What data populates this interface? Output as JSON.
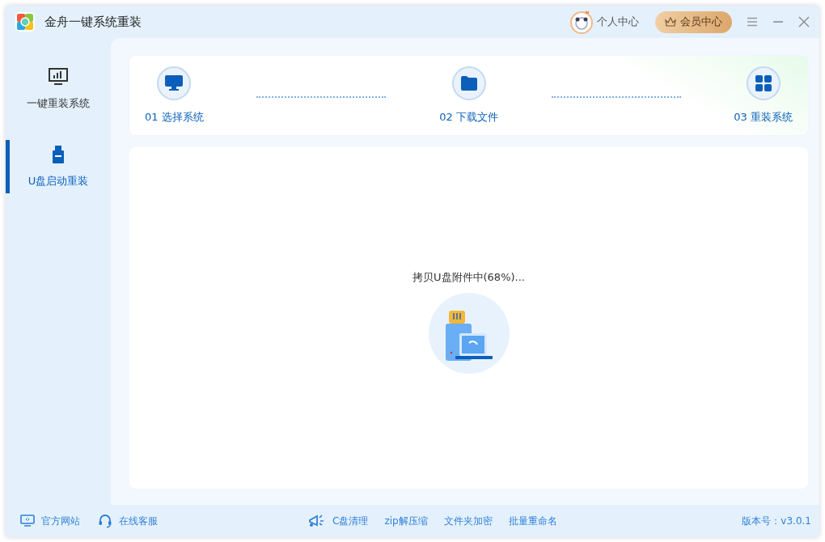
{
  "window": {
    "title": "金舟一键系统重装"
  },
  "header": {
    "user_center": "个人中心",
    "vip_center": "会员中心"
  },
  "sidebar": {
    "items": [
      {
        "label": "一键重装系统",
        "kind": "monitor",
        "selected": false
      },
      {
        "label": "U盘启动重装",
        "kind": "usb",
        "selected": true
      }
    ]
  },
  "steps": [
    {
      "label": "01 选择系统",
      "kind": "monitor"
    },
    {
      "label": "02 下载文件",
      "kind": "folder"
    },
    {
      "label": "03 重装系统",
      "kind": "grid"
    }
  ],
  "progress": {
    "message": "拷贝U盘附件中(68%)..."
  },
  "footer": {
    "left": [
      {
        "label": "官方网站",
        "kind": "monitor"
      },
      {
        "label": "在线客服",
        "kind": "headset"
      }
    ],
    "tools": [
      {
        "label": "C盘清理",
        "kind": "megaphone"
      },
      {
        "label": "zip解压缩",
        "kind": "text"
      },
      {
        "label": "文件夹加密",
        "kind": "text"
      },
      {
        "label": "批量重命名",
        "kind": "text"
      }
    ],
    "version": "版本号：v3.0.1"
  }
}
